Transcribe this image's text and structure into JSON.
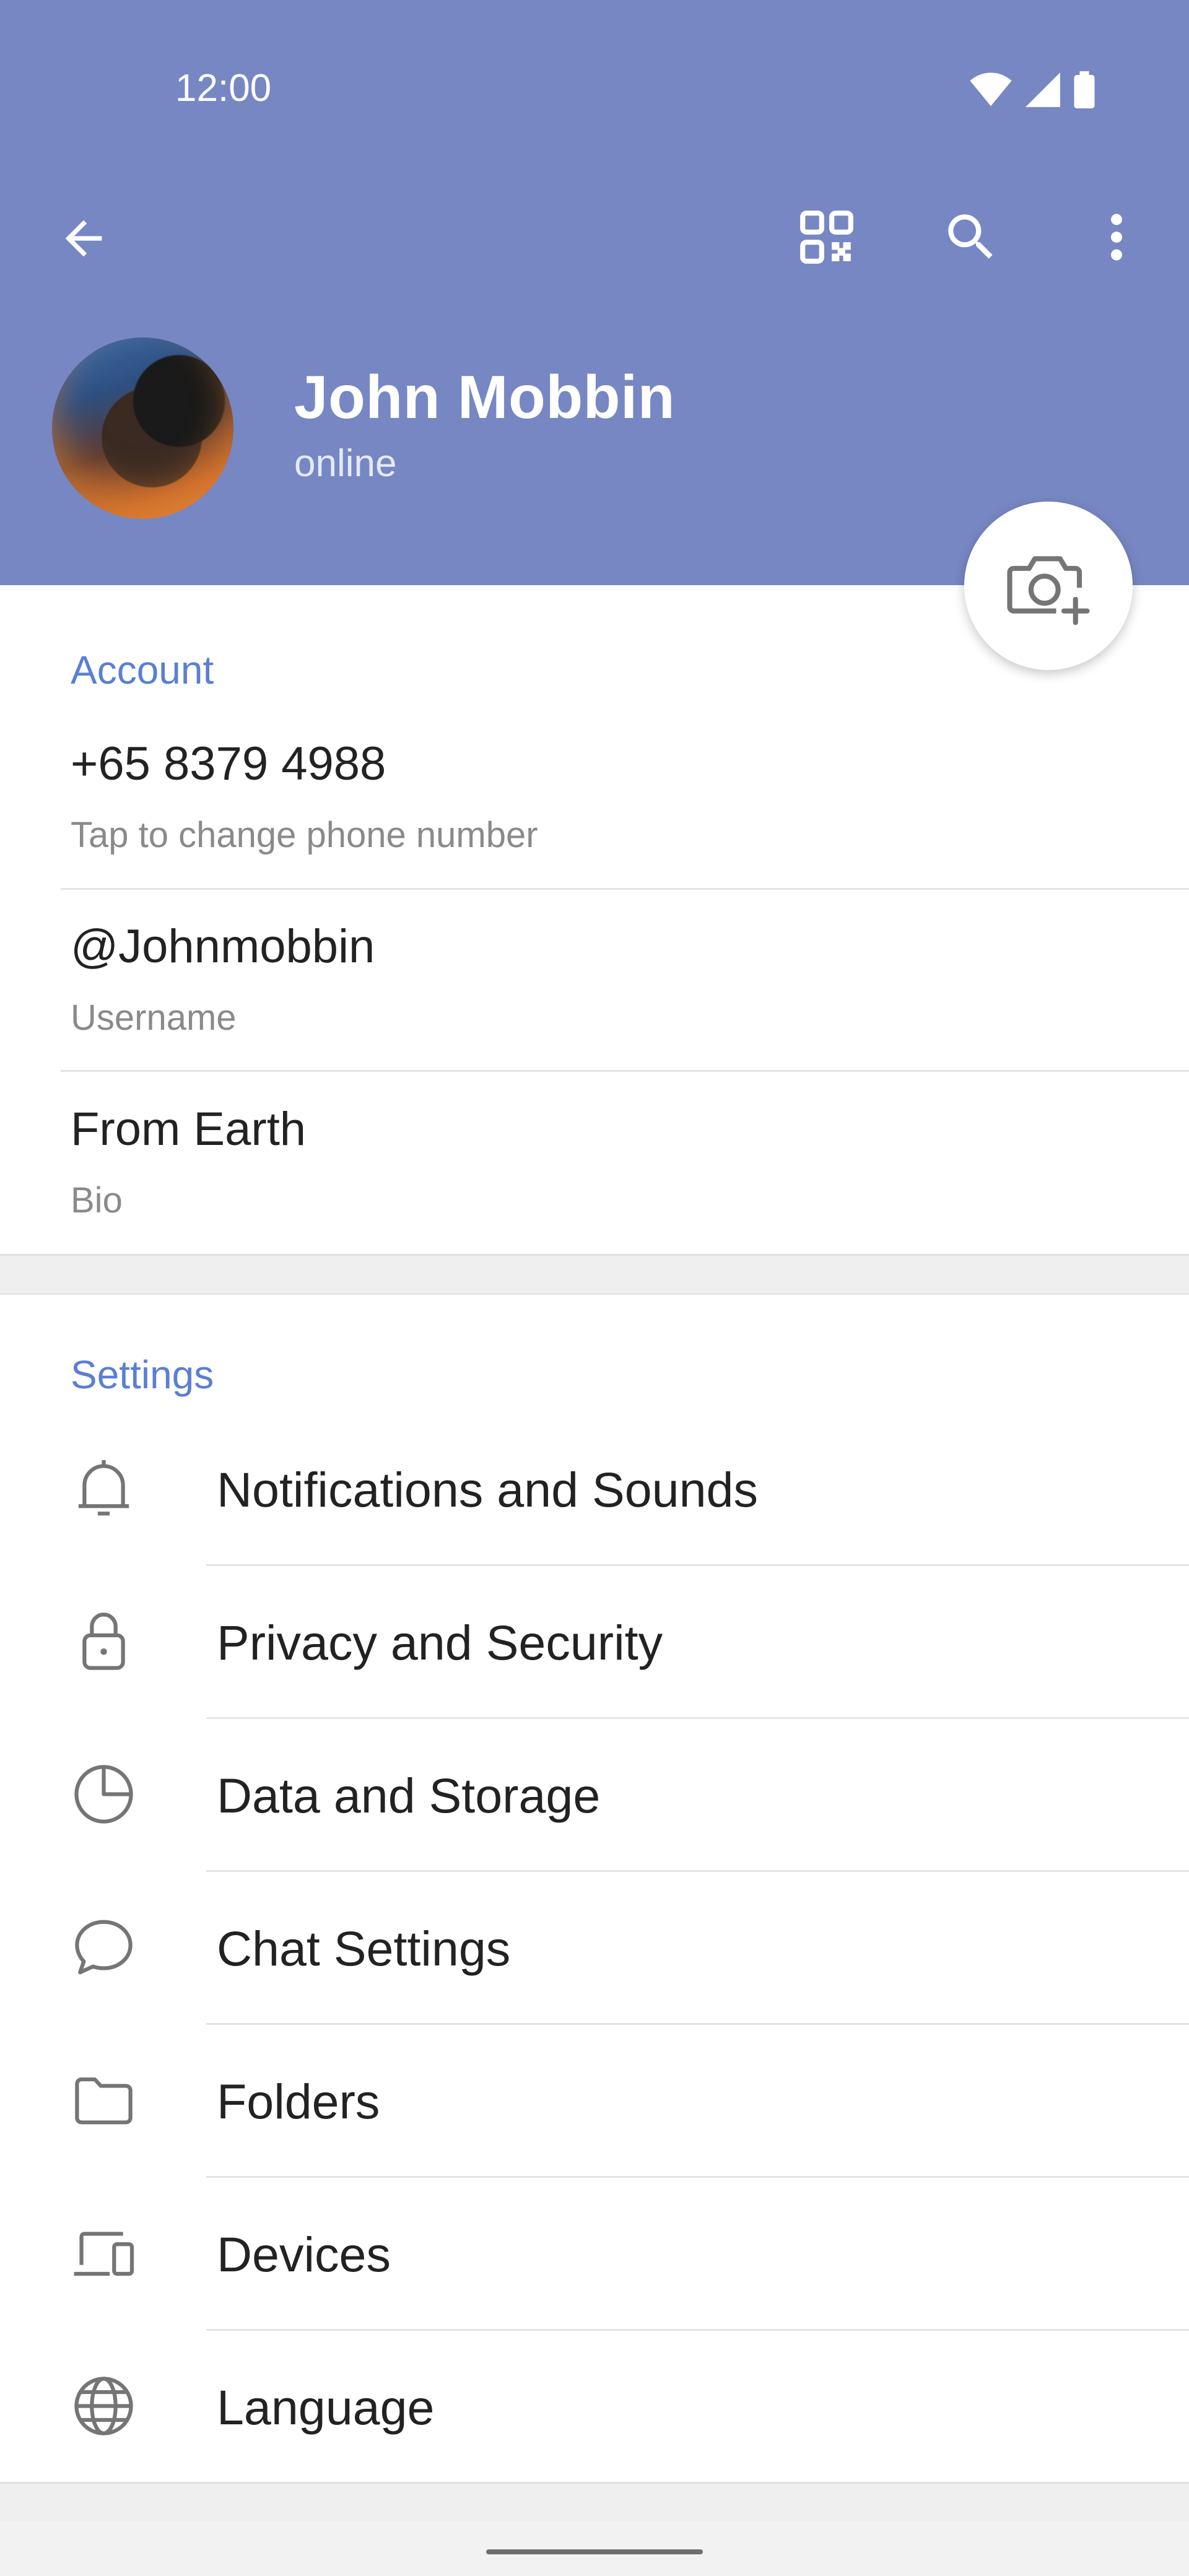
{
  "status_bar": {
    "time": "12:00"
  },
  "profile": {
    "name": "John Mobbin",
    "status": "online"
  },
  "account": {
    "title": "Account",
    "phone": {
      "value": "+65 8379 4988",
      "hint": "Tap to change phone number"
    },
    "username": {
      "value": "@Johnmobbin",
      "hint": "Username"
    },
    "bio": {
      "value": "From Earth",
      "hint": "Bio"
    }
  },
  "settings": {
    "title": "Settings",
    "items": [
      {
        "label": "Notifications and Sounds",
        "icon": "bell-icon"
      },
      {
        "label": "Privacy and Security",
        "icon": "lock-icon"
      },
      {
        "label": "Data and Storage",
        "icon": "pie-chart-icon"
      },
      {
        "label": "Chat Settings",
        "icon": "chat-bubble-icon"
      },
      {
        "label": "Folders",
        "icon": "folder-icon"
      },
      {
        "label": "Devices",
        "icon": "devices-icon"
      },
      {
        "label": "Language",
        "icon": "globe-icon"
      }
    ]
  },
  "colors": {
    "header": "#7787c3",
    "accent": "#5a7fd3",
    "text": "#222222",
    "subtext": "#8a8a8a"
  }
}
